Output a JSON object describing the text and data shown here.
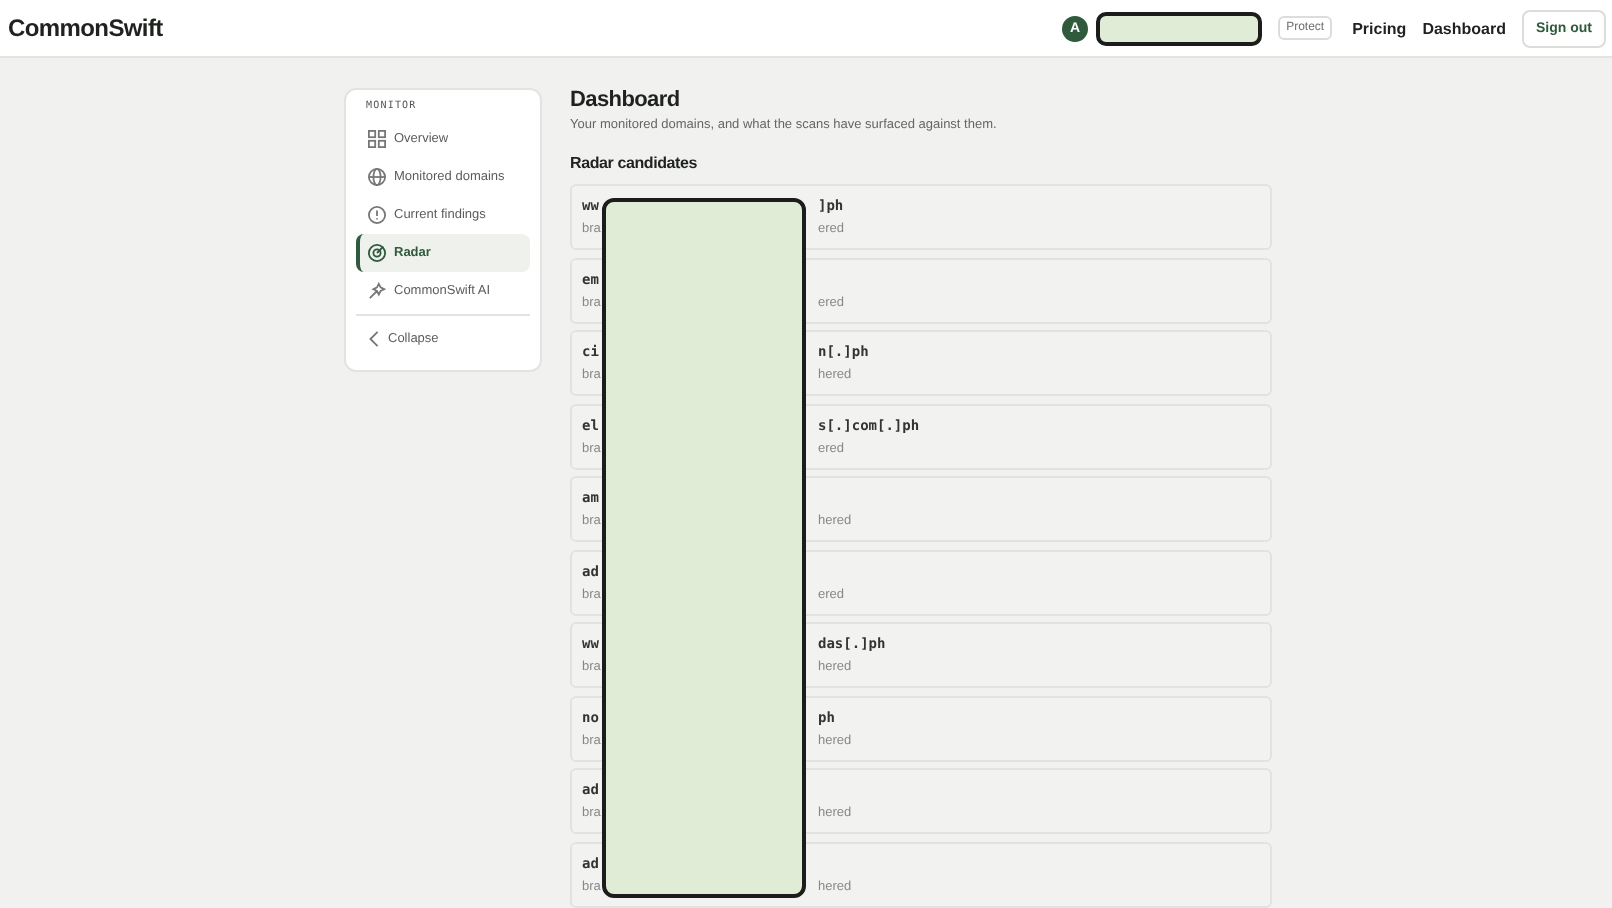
{
  "navbar": {
    "logo": "CommonSwift",
    "avatar": "A",
    "links": [
      {
        "label": "Protect",
        "kind": "chip"
      },
      {
        "label": "Pricing",
        "kind": "link"
      },
      {
        "label": "Dashboard",
        "kind": "link"
      },
      {
        "label": "Sign out",
        "kind": "button"
      }
    ]
  },
  "sidebar": {
    "section": "MONITOR",
    "items": [
      {
        "label": "Overview",
        "selected": false
      },
      {
        "label": "Monitored domains",
        "selected": false
      },
      {
        "label": "Current findings",
        "selected": false
      },
      {
        "label": "Radar",
        "selected": true
      },
      {
        "label": "CommonSwift AI",
        "selected": false
      }
    ],
    "collapse": "Collapse"
  },
  "main": {
    "title": "Dashboard",
    "subtitle": "Your monitored domains, and what the scans have surfaced against them.",
    "section": "Radar candidates",
    "rows": [
      {
        "domain_left": "ww",
        "domain_right": "]ph",
        "meta_left": "bra",
        "meta_right": "ered"
      },
      {
        "domain_left": "em",
        "meta_left": "bra",
        "meta_right": "ered"
      },
      {
        "domain_left": "ci",
        "domain_right": "n[.]ph",
        "meta_left": "bra",
        "meta_right": "hered"
      },
      {
        "domain_left": "el",
        "domain_right": "s[.]com[.]ph",
        "meta_left": "bra",
        "meta_right": "ered"
      },
      {
        "domain_left": "am",
        "meta_left": "bra",
        "meta_right": "hered"
      },
      {
        "domain_left": "ad",
        "meta_left": "bra",
        "meta_right": "ered"
      },
      {
        "domain_left": "ww",
        "domain_right": "das[.]ph",
        "meta_left": "bra",
        "meta_right": "hered"
      },
      {
        "domain_left": "no",
        "domain_right": "ph",
        "meta_left": "bra",
        "meta_right": "hered"
      },
      {
        "domain_left": "ad",
        "meta_left": "bra",
        "meta_right": "hered"
      },
      {
        "domain_left": "ad",
        "meta_left": "bra",
        "meta_right": "hered"
      }
    ]
  }
}
